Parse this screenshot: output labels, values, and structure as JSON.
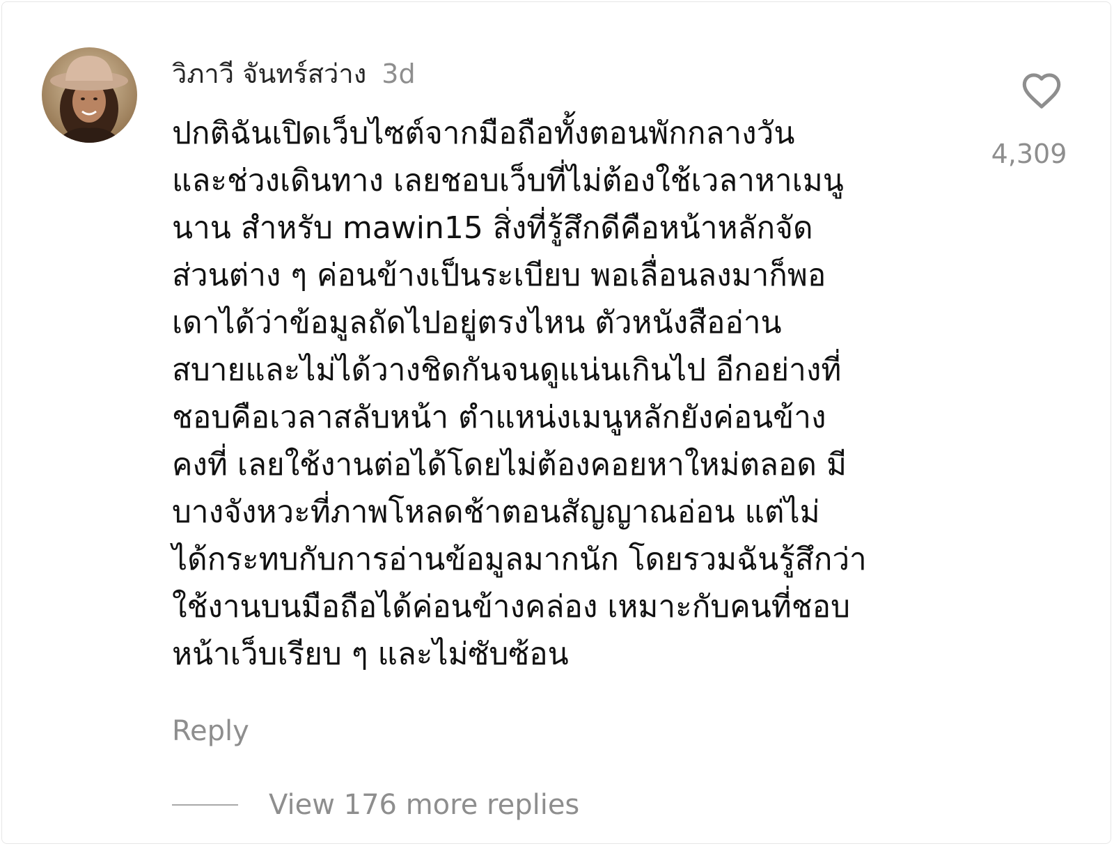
{
  "comment": {
    "author": "วิภาวี จันทร์สว่าง",
    "time": "3d",
    "body": "ปกติฉันเปิดเว็บไซต์จากมือถือทั้งตอนพักกลางวัน\nและช่วงเดินทาง เลยชอบเว็บที่ไม่ต้องใช้เวลาหาเมนู\nนาน สำหรับ mawin15 สิ่งที่รู้สึกดีคือหน้าหลักจัด\nส่วนต่าง ๆ ค่อนข้างเป็นระเบียบ พอเลื่อนลงมาก็พอ\nเดาได้ว่าข้อมูลถัดไปอยู่ตรงไหน ตัวหนังสืออ่าน\nสบายและไม่ได้วางชิดกันจนดูแน่นเกินไป อีกอย่างที่\nชอบคือเวลาสลับหน้า ตำแหน่งเมนูหลักยังค่อนข้าง\nคงที่ เลยใช้งานต่อได้โดยไม่ต้องคอยหาใหม่ตลอด มี\nบางจังหวะที่ภาพโหลดช้าตอนสัญญาณอ่อน แต่ไม่\nได้กระทบกับการอ่านข้อมูลมากนัก โดยรวมฉันรู้สึกว่า\nใช้งานบนมือถือได้ค่อนข้างคล่อง เหมาะกับคนที่ชอบ\nหน้าเว็บเรียบ ๆ และไม่ซับซ้อน",
    "like_count": "4,309",
    "like_icon": "heart-outline-icon",
    "reply_label": "Reply",
    "view_replies_label": "View 176 more replies"
  },
  "colors": {
    "text_primary": "#111111",
    "text_secondary": "#8e8e8e",
    "background": "#ffffff",
    "divider": "#a8a8a8"
  }
}
